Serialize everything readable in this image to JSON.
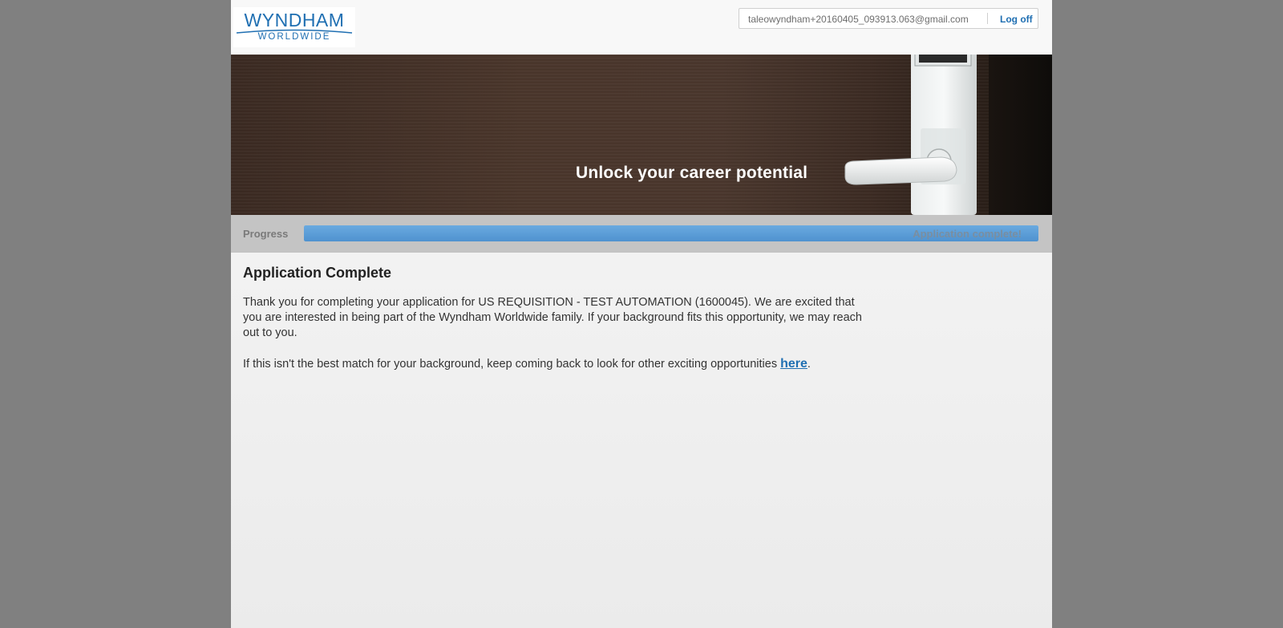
{
  "header": {
    "logo": {
      "line1": "WYNDHAM",
      "line2": "WORLDWIDE"
    },
    "user_email": "taleowyndham+20160405_093913.063@gmail.com",
    "logoff_label": "Log off"
  },
  "banner": {
    "tagline": "Unlock your career potential"
  },
  "progress": {
    "label": "Progress",
    "status_text": "Application complete!",
    "percent": 100
  },
  "content": {
    "title": "Application Complete",
    "paragraph1": "Thank you for completing your application for US REQUISITION - TEST AUTOMATION (1600045). We are excited that you are interested in being part of the Wyndham Worldwide family. If your background fits this opportunity, we may reach out to you.",
    "paragraph2_prefix": "If this isn't the best match for your background, keep coming back to look for other exciting opportunities ",
    "paragraph2_link": "here",
    "paragraph2_suffix": "."
  },
  "colors": {
    "brand_blue": "#1f6fb2",
    "progress_fill": "#4f92cf",
    "outer_background": "#808080"
  }
}
